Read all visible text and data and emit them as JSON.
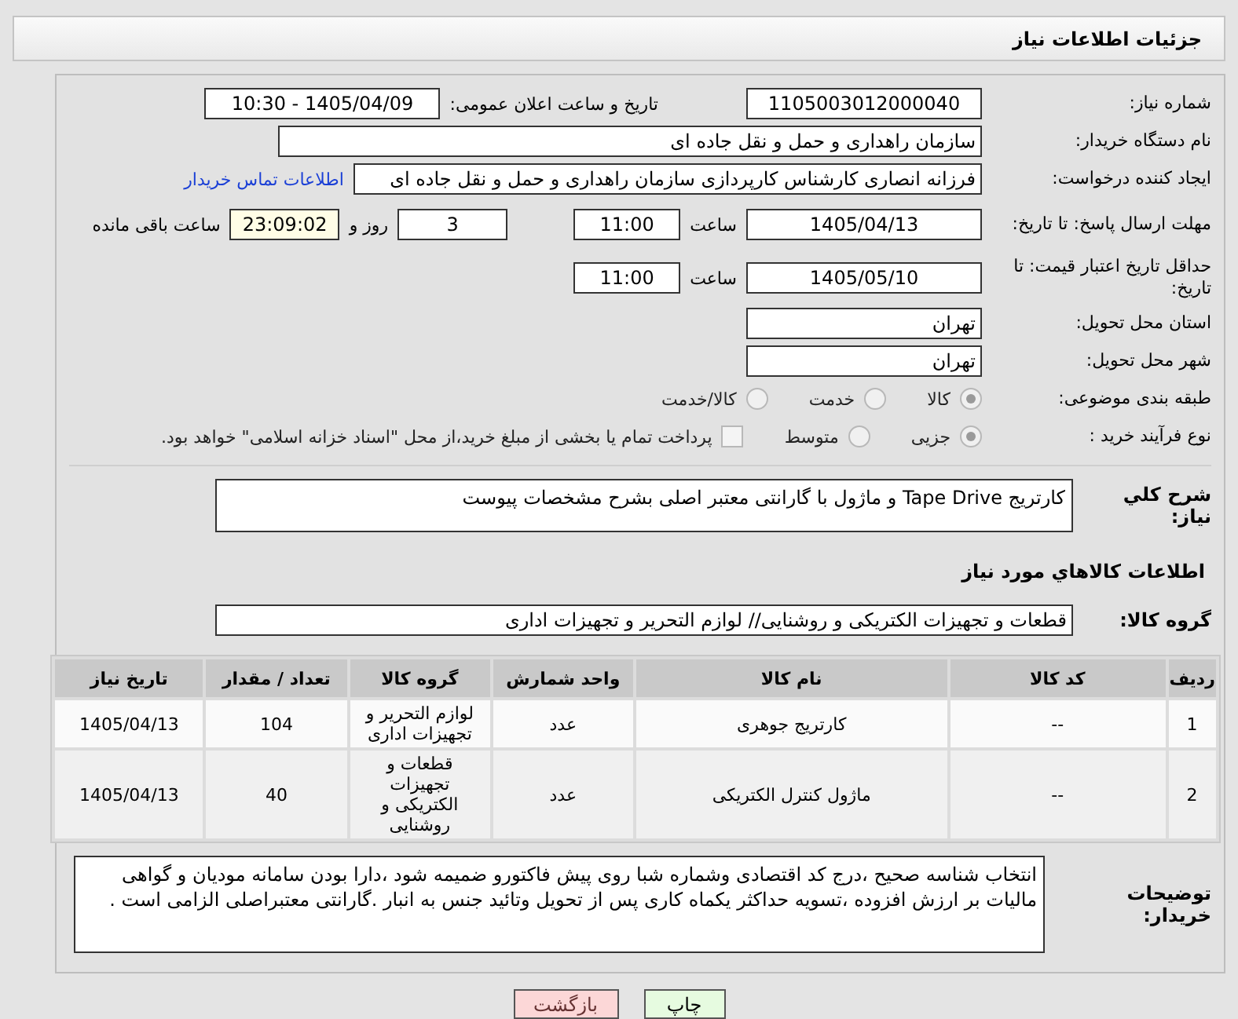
{
  "header": {
    "title": "جزئیات اطلاعات نیاز"
  },
  "need_number": {
    "label": "شماره نیاز:",
    "value": "1105003012000040"
  },
  "announce": {
    "label": "تاریخ و ساعت اعلان عمومی:",
    "value": "1405/04/09 - 10:30"
  },
  "buyer_org": {
    "label": "نام دستگاه خریدار:",
    "value": "سازمان راهداری و حمل و نقل جاده ای"
  },
  "requester": {
    "label": "ایجاد کننده درخواست:",
    "value": "فرزانه انصاری کارشناس کارپردازی سازمان راهداری و حمل و نقل جاده ای",
    "link": "اطلاعات تماس خریدار"
  },
  "response_deadline": {
    "label": "مهلت ارسال پاسخ: تا تاریخ:",
    "date": "1405/04/13",
    "time_label": "ساعت",
    "time": "11:00",
    "days": "3",
    "days_label": "روز و",
    "remaining": "23:09:02",
    "remaining_label": "ساعت باقی مانده"
  },
  "price_validity": {
    "label": "حداقل تاریخ اعتبار قیمت: تا تاریخ:",
    "date": "1405/05/10",
    "time_label": "ساعت",
    "time": "11:00"
  },
  "province": {
    "label": "استان محل تحویل:",
    "value": "تهران"
  },
  "city": {
    "label": "شهر محل تحویل:",
    "value": "تهران"
  },
  "category": {
    "label": "طبقه بندی موضوعی:",
    "options": [
      {
        "label": "کالا",
        "selected": true
      },
      {
        "label": "خدمت",
        "selected": false
      },
      {
        "label": "کالا/خدمت",
        "selected": false
      }
    ]
  },
  "process": {
    "label": "نوع فرآیند خرید :",
    "options": [
      {
        "label": "جزیی",
        "selected": true
      },
      {
        "label": "متوسط",
        "selected": false
      }
    ],
    "payment_note": {
      "label": "پرداخت تمام یا بخشی از مبلغ خرید،از محل \"اسناد خزانه اسلامی\" خواهد بود.",
      "checked": false
    }
  },
  "description": {
    "label": "شرح كلي نياز:",
    "value": "کارتریج Tape Drive و ماژول با گارانتی معتبر اصلی بشرح مشخصات پیوست"
  },
  "items_heading": "اطلاعات كالاهاي مورد نياز",
  "goods_group": {
    "label": "گروه کالا:",
    "value": "قطعات و تجهیزات الکتریکی و روشنایی// لوازم التحریر و تجهیزات اداری"
  },
  "table": {
    "columns": [
      "ردیف",
      "کد کالا",
      "نام کالا",
      "واحد شمارش",
      "گروه کالا",
      "تعداد / مقدار",
      "تاریخ نیاز"
    ],
    "rows": [
      [
        "1",
        "--",
        "کارتریج جوهری",
        "عدد",
        "لوازم التحریر و تجهیزات اداری",
        "104",
        "1405/04/13"
      ],
      [
        "2",
        "--",
        "ماژول کنترل الکتریکی",
        "عدد",
        "قطعات و تجهیزات الکتریکی و روشنایی",
        "40",
        "1405/04/13"
      ]
    ]
  },
  "buyer_notes": {
    "label": "توضیحات خریدار:",
    "value": "انتخاب شناسه صحیح ،درج کد اقتصادی وشماره شبا روی پیش فاکتورو ضمیمه شود ،دارا بودن سامانه مودیان و گواهی مالیات بر ارزش افزوده ،تسویه حداکثر یکماه کاری پس از تحویل وتائید جنس به انبار .گارانتی معتبراصلی الزامی است ."
  },
  "buttons": [
    {
      "label": "چاپ",
      "kind": "print"
    },
    {
      "label": "بازگشت",
      "kind": "back"
    }
  ]
}
